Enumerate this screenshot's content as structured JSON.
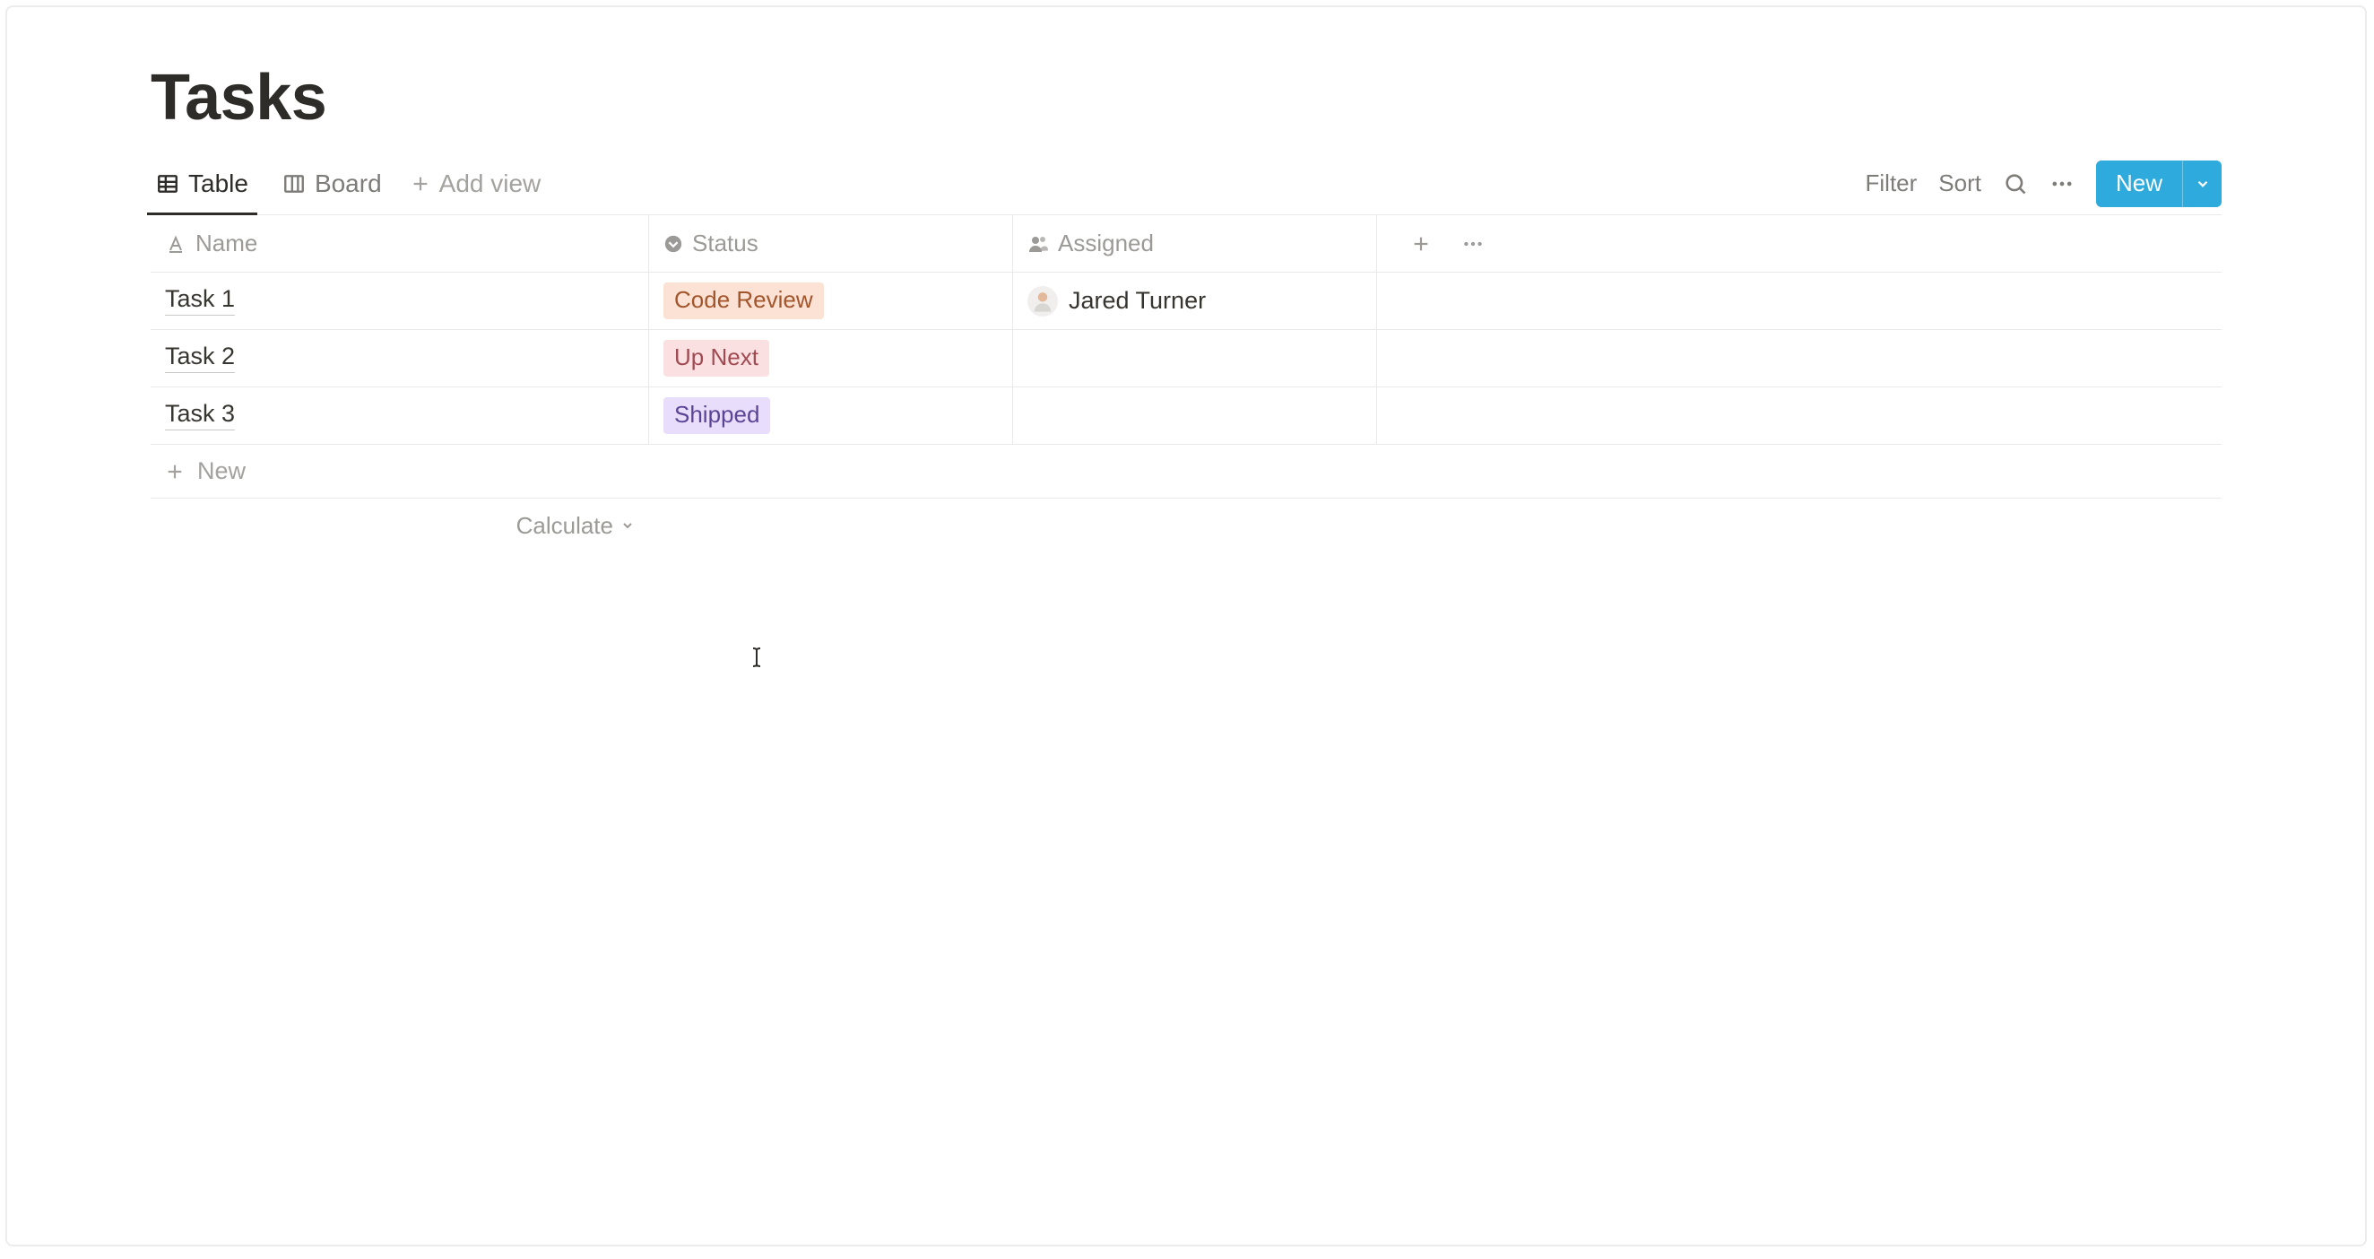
{
  "page": {
    "title": "Tasks"
  },
  "views": {
    "tabs": [
      {
        "label": "Table",
        "icon": "table"
      },
      {
        "label": "Board",
        "icon": "board"
      }
    ],
    "add_view_label": "Add view"
  },
  "toolbar": {
    "filter_label": "Filter",
    "sort_label": "Sort",
    "new_label": "New"
  },
  "columns": {
    "name": "Name",
    "status": "Status",
    "assigned": "Assigned"
  },
  "rows": [
    {
      "name": "Task 1",
      "status": {
        "label": "Code Review",
        "color": "orange"
      },
      "assigned": "Jared Turner"
    },
    {
      "name": "Task 2",
      "status": {
        "label": "Up Next",
        "color": "pink"
      },
      "assigned": ""
    },
    {
      "name": "Task 3",
      "status": {
        "label": "Shipped",
        "color": "purple"
      },
      "assigned": ""
    }
  ],
  "footer": {
    "new_row_label": "New",
    "calculate_label": "Calculate"
  }
}
